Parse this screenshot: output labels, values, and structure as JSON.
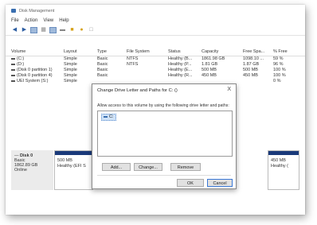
{
  "window": {
    "title": "Disk Management"
  },
  "menu": [
    "File",
    "Action",
    "View",
    "Help"
  ],
  "toolbar_icons": [
    "back-arrow-icon",
    "forward-arrow-icon",
    "grid-icon",
    "help-icon",
    "properties-icon",
    "folder-icon",
    "check-icon",
    "key-icon",
    "window-icon"
  ],
  "volumes": {
    "columns": [
      "Volume",
      "Layout",
      "Type",
      "File System",
      "Status",
      "Capacity",
      "Free Spa...",
      "% Free"
    ],
    "rows": [
      [
        "(C:)",
        "Simple",
        "Basic",
        "NTFS",
        "Healthy (B...",
        "1861.98 GB",
        "1098.10 ...",
        "59 %"
      ],
      [
        "(D:)",
        "Simple",
        "Basic",
        "NTFS",
        "Healthy (P...",
        "1.81 GB",
        "1.87 GB",
        "96 %"
      ],
      [
        "(Disk 0 partition 1)",
        "Simple",
        "Basic",
        "",
        "Healthy (E...",
        "500 MB",
        "500 MB",
        "100 %"
      ],
      [
        "(Disk 0 partition 4)",
        "Simple",
        "Basic",
        "",
        "Healthy (R...",
        "450 MB",
        "450 MB",
        "100 %"
      ],
      [
        "UEI System (S:)",
        "Simple",
        "",
        "",
        "",
        "",
        "",
        "0 %"
      ]
    ]
  },
  "disk0": {
    "name": "Disk 0",
    "type": "Basic",
    "size": "1862.89 GB",
    "status": "Online",
    "part1": {
      "size": "500 MB",
      "status": "Healthy (EFI S"
    },
    "part2": {
      "size": "450 MB",
      "status": "Healthy ("
    }
  },
  "dialog": {
    "title": "Change Drive Letter and Paths for C: ()",
    "close": "X",
    "message": "Allow access to this volume by using the following drive letter and paths:",
    "list_item": "C:",
    "add": "Add...",
    "change": "Change...",
    "remove": "Remove",
    "ok": "OK",
    "cancel": "Cancel"
  }
}
